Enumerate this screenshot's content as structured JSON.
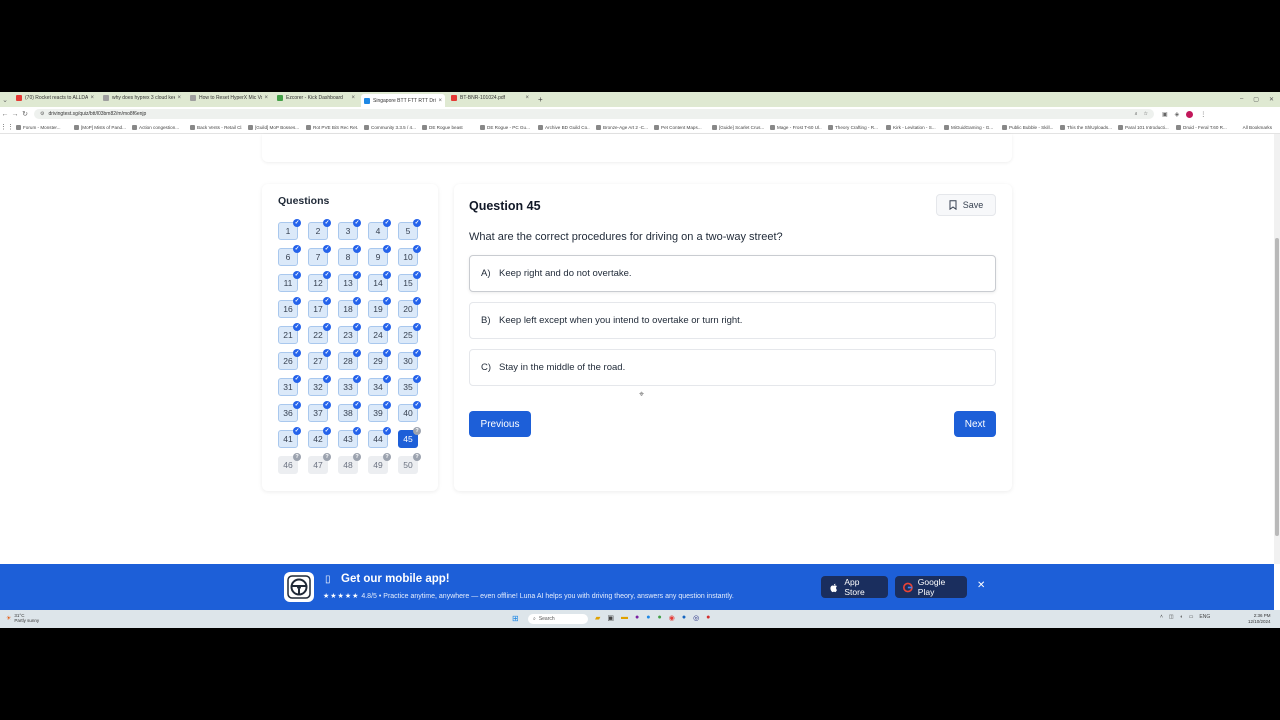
{
  "browser": {
    "tabs": [
      {
        "title": "(70) Rocket reacts to ALLDAY F",
        "color": "#e53935",
        "active": false
      },
      {
        "title": "why does hyprex 3 cloud keep",
        "color": "#9e9e9e",
        "active": false
      },
      {
        "title": "How to Reset HyperX Mic Volu",
        "color": "#9e9e9e",
        "active": false
      },
      {
        "title": "Ezcorer - Kick Dashboard",
        "color": "#43a047",
        "active": false
      },
      {
        "title": "Singapore BTT FTT RTT Driving",
        "color": "#1e88e5",
        "active": true
      },
      {
        "title": "BT-BNR-101024.pdf",
        "color": "#e53935",
        "active": false
      }
    ],
    "url": "drivingtest.sg/quiz/btt/l03bm82/m/mo8f6enjp",
    "bookmarks": [
      "Forum - Monster...",
      "[MoP] Mists of Pand...",
      "Action congestion...",
      "Back Vents - Retail Cl...",
      "[Guild] MoP Bosses...",
      "Rot PVE BiS Rec Ret...",
      "Community 3.3.5 / 4...",
      "DE Rogue beast",
      "DE Rogue - PC Gu...",
      "Archive BD Guild Co...",
      "Bronze-Age Art 2 -C...",
      "Pet Content Maps...",
      "[Guide] Scarlet Crus...",
      "Mage - Frost T-60 Ul...",
      "Theory Crafting - R...",
      "Kirk - Levitation - S...",
      "MiGuidGaming - G...",
      "Public Bubble - Skill...",
      "This the ShlUploads...",
      "Paral 101 Introducti...",
      "Druid - Feral T.60 R..."
    ],
    "all_bookmarks": "All Bookmarks"
  },
  "quiz": {
    "panel_title": "Questions",
    "numbers": [
      {
        "n": "1",
        "state": "done"
      },
      {
        "n": "2",
        "state": "done"
      },
      {
        "n": "3",
        "state": "done"
      },
      {
        "n": "4",
        "state": "done"
      },
      {
        "n": "5",
        "state": "done"
      },
      {
        "n": "6",
        "state": "done"
      },
      {
        "n": "7",
        "state": "done"
      },
      {
        "n": "8",
        "state": "done"
      },
      {
        "n": "9",
        "state": "done"
      },
      {
        "n": "10",
        "state": "done"
      },
      {
        "n": "11",
        "state": "done"
      },
      {
        "n": "12",
        "state": "done"
      },
      {
        "n": "13",
        "state": "done"
      },
      {
        "n": "14",
        "state": "done"
      },
      {
        "n": "15",
        "state": "done"
      },
      {
        "n": "16",
        "state": "done"
      },
      {
        "n": "17",
        "state": "done"
      },
      {
        "n": "18",
        "state": "done"
      },
      {
        "n": "19",
        "state": "done"
      },
      {
        "n": "20",
        "state": "done"
      },
      {
        "n": "21",
        "state": "done"
      },
      {
        "n": "22",
        "state": "done"
      },
      {
        "n": "23",
        "state": "done"
      },
      {
        "n": "24",
        "state": "done"
      },
      {
        "n": "25",
        "state": "done"
      },
      {
        "n": "26",
        "state": "done"
      },
      {
        "n": "27",
        "state": "done"
      },
      {
        "n": "28",
        "state": "done"
      },
      {
        "n": "29",
        "state": "done"
      },
      {
        "n": "30",
        "state": "done"
      },
      {
        "n": "31",
        "state": "done"
      },
      {
        "n": "32",
        "state": "done"
      },
      {
        "n": "33",
        "state": "done"
      },
      {
        "n": "34",
        "state": "done"
      },
      {
        "n": "35",
        "state": "done"
      },
      {
        "n": "36",
        "state": "done"
      },
      {
        "n": "37",
        "state": "done"
      },
      {
        "n": "38",
        "state": "done"
      },
      {
        "n": "39",
        "state": "done"
      },
      {
        "n": "40",
        "state": "done"
      },
      {
        "n": "41",
        "state": "done"
      },
      {
        "n": "42",
        "state": "done"
      },
      {
        "n": "43",
        "state": "done"
      },
      {
        "n": "44",
        "state": "done"
      },
      {
        "n": "45",
        "state": "current"
      },
      {
        "n": "46",
        "state": "pending"
      },
      {
        "n": "47",
        "state": "pending"
      },
      {
        "n": "48",
        "state": "pending"
      },
      {
        "n": "49",
        "state": "pending"
      },
      {
        "n": "50",
        "state": "pending"
      }
    ],
    "question_title": "Question 45",
    "save_label": "Save",
    "question_text": "What are the correct procedures for driving on a two-way street?",
    "options": [
      {
        "letter": "A)",
        "text": "Keep right and do not overtake."
      },
      {
        "letter": "B)",
        "text": "Keep left except when you intend to overtake or turn right."
      },
      {
        "letter": "C)",
        "text": "Stay in the middle of the road."
      }
    ],
    "previous_label": "Previous",
    "next_label": "Next"
  },
  "banner": {
    "title": "Get our mobile app!",
    "stars": "★★★★★",
    "rating": "4.8/5",
    "subtitle": "• Practice anytime, anywhere — even offline! Luna AI helps you with driving theory, answers any question instantly.",
    "app_store": "App Store",
    "google_play": "Google Play",
    "close": "✕"
  },
  "taskbar": {
    "weather_temp": "31°C",
    "weather_desc": "Partly sunny",
    "search": "Search",
    "lang": "ENG",
    "time": "2:36 PM",
    "date": "12/10/2024"
  },
  "colors": {
    "primary": "#1d5fd8",
    "answered_bg": "#dbe9f9",
    "pending_bg": "#eceef1"
  }
}
